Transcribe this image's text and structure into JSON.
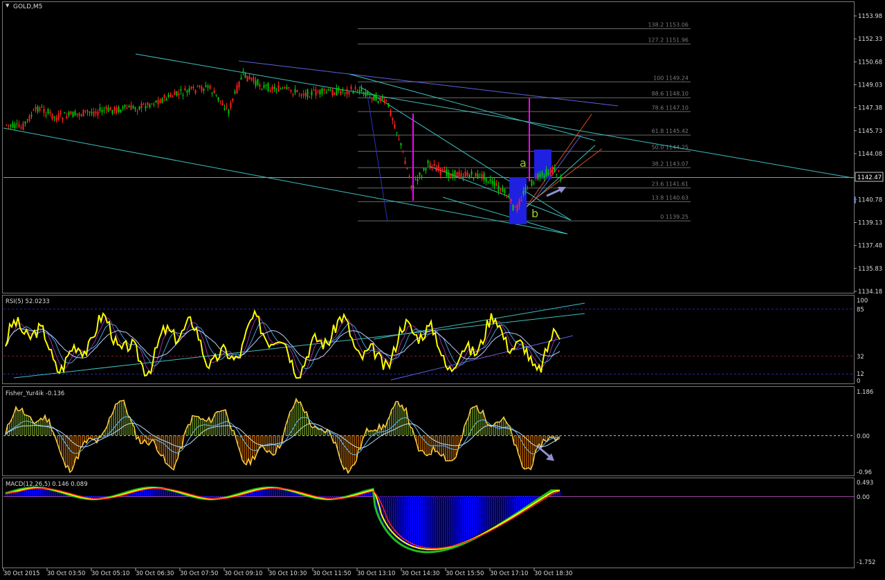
{
  "window": {
    "symbol_label": "GOLD,M5"
  },
  "price_axis": {
    "ticks": [
      "1153.98",
      "1152.33",
      "1150.68",
      "1149.03",
      "1147.38",
      "1145.73",
      "1144.08",
      "1142.47",
      "1140.78",
      "1139.13",
      "1137.48",
      "1135.83",
      "1134.18"
    ],
    "current_price": "1142.47"
  },
  "time_axis": {
    "labels": [
      "30 Oct 2015",
      "30 Oct 03:50",
      "30 Oct 05:10",
      "30 Oct 06:30",
      "30 Oct 07:50",
      "30 Oct 09:10",
      "30 Oct 10:30",
      "30 Oct 11:50",
      "30 Oct 13:10",
      "30 Oct 14:30",
      "30 Oct 15:50",
      "30 Oct 17:10",
      "30 Oct 18:30"
    ]
  },
  "fibonacci": {
    "levels": [
      {
        "label": "138.2 1153.06",
        "price": 1153.06
      },
      {
        "label": "127.2 1151.96",
        "price": 1151.96
      },
      {
        "label": "100 1149.24",
        "price": 1149.24
      },
      {
        "label": "88.6 1148.10",
        "price": 1148.1
      },
      {
        "label": "78.6 1147.10",
        "price": 1147.1
      },
      {
        "label": "61.8 1145.42",
        "price": 1145.42
      },
      {
        "label": "50.0 1144.25",
        "price": 1144.25
      },
      {
        "label": "38.2 1143.07",
        "price": 1143.07
      },
      {
        "label": "23.6 1141.61",
        "price": 1141.61
      },
      {
        "label": "13.8 1140.63",
        "price": 1140.63
      },
      {
        "label": "0 1139.25",
        "price": 1139.25
      }
    ]
  },
  "wave_labels": {
    "a": "a",
    "b": "b"
  },
  "rsi": {
    "title": "RSI(5) 52.0233",
    "levels": [
      "100",
      "85",
      "32",
      "12",
      "0"
    ]
  },
  "fisher": {
    "title": "Fisher_Yur4ik -0.136",
    "levels": [
      "1.186",
      "0.00",
      "-0.96"
    ]
  },
  "macd": {
    "title": "MACD(12,26,5) 0.146 0.089",
    "levels": [
      "0.493",
      "0.00",
      "-1.752"
    ]
  },
  "colors": {
    "background": "#000000",
    "grid": "#6b6b6b",
    "bull_candle": "#00c800",
    "bear_candle": "#ff2020",
    "channel": "#40c0c0",
    "fib": "#6b6b6b",
    "rsi_main": "#ffff00",
    "fisher_pos": "#9acd32",
    "fisher_neg": "#ff8c00",
    "macd_hist": "#0000ff",
    "signal_magenta": "#ff00ff"
  },
  "chart_data": [
    {
      "type": "line",
      "title": "GOLD,M5",
      "ylim": [
        1134.18,
        1153.98
      ],
      "x": [
        "30 Oct 2015",
        "30 Oct 03:50",
        "30 Oct 05:10",
        "30 Oct 06:30",
        "30 Oct 07:50",
        "30 Oct 09:10",
        "30 Oct 10:30",
        "30 Oct 11:50",
        "30 Oct 13:10",
        "30 Oct 14:30",
        "30 Oct 15:50",
        "30 Oct 17:10",
        "30 Oct 18:30"
      ],
      "series": [
        {
          "values": [
            1146.1,
            1147.0,
            1146.9,
            1147.8,
            1148.7,
            1149.4,
            1148.9,
            1148.5,
            1147.2,
            1142.4,
            1142.1,
            1141.5,
            1142.3
          ]
        }
      ]
    },
    {
      "type": "line",
      "title": "RSI(5) 52.0233",
      "ylim": [
        0,
        100
      ],
      "series": [
        {
          "values": [
            50,
            58,
            52,
            72,
            48,
            65,
            55,
            50,
            45,
            25,
            55,
            45,
            52
          ]
        }
      ]
    },
    {
      "type": "bar",
      "title": "Fisher_Yur4ik -0.136",
      "ylim": [
        -0.96,
        1.186
      ],
      "series": [
        {
          "values": [
            0.6,
            0.4,
            0.2,
            0.3,
            0.5,
            -0.5,
            -0.4,
            -0.3,
            -0.2,
            0.9,
            -0.2,
            0.5,
            -0.136
          ]
        }
      ]
    },
    {
      "type": "bar",
      "title": "MACD(12,26,5) 0.146 0.089",
      "ylim": [
        -1.752,
        0.493
      ],
      "series": [
        {
          "values": [
            -0.2,
            0.1,
            0.05,
            0.15,
            0.25,
            0.1,
            0.0,
            -0.05,
            -0.1,
            -1.5,
            -0.9,
            -0.7,
            0.146
          ]
        }
      ]
    }
  ]
}
